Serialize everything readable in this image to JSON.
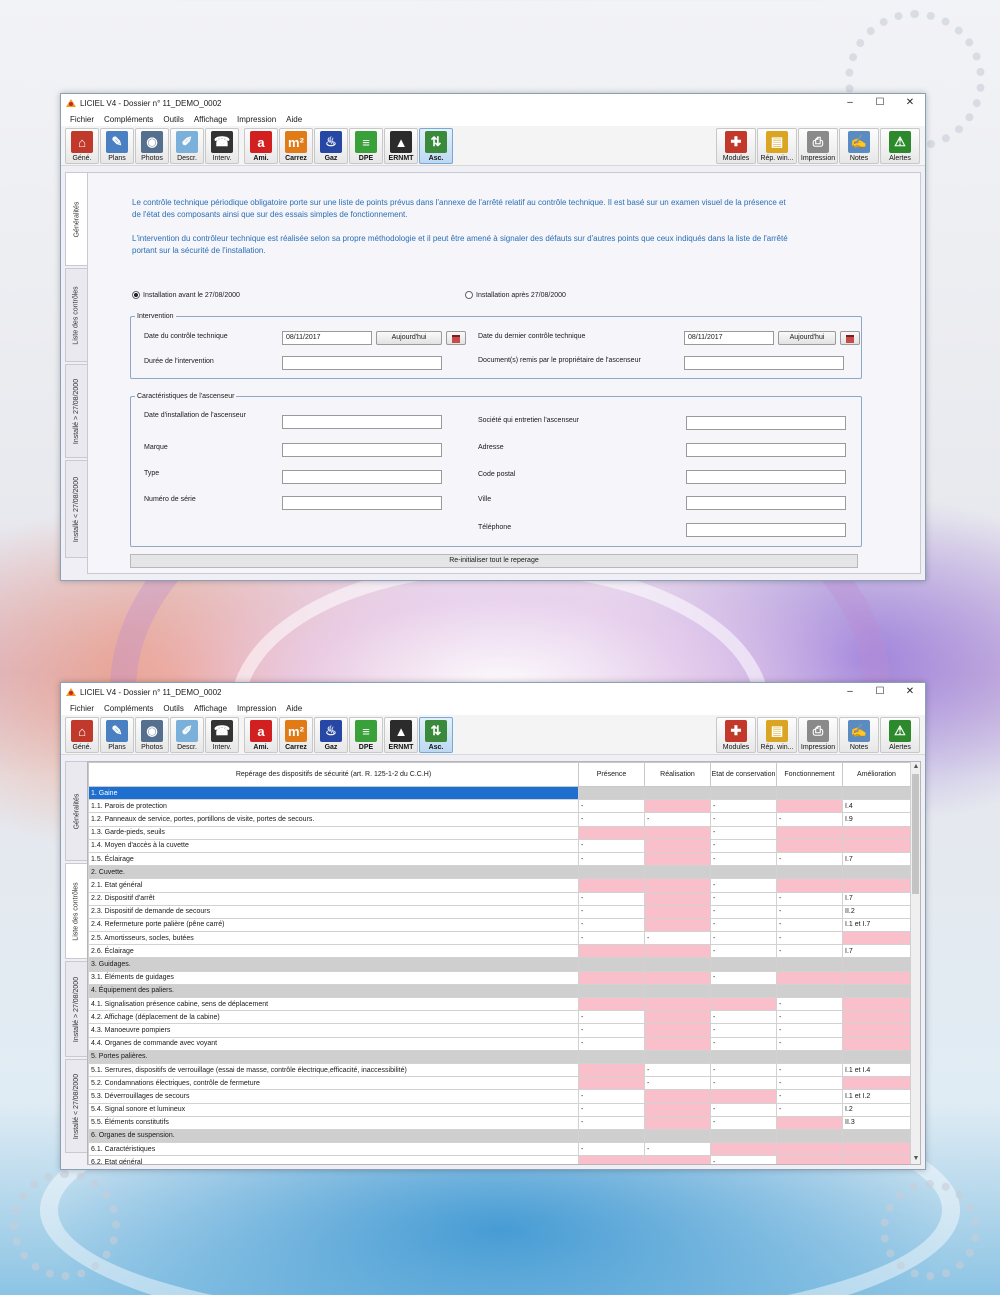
{
  "window1": {
    "title": "LICIEL V4 - Dossier n° 11_DEMO_0002",
    "vtabs": [
      "Généralités",
      "Liste des contrôles",
      "Installé > 27/08/2000",
      "Installé < 27/08/2000"
    ],
    "intro_p1": "Le contrôle technique périodique obligatoire porte sur une liste de points prévus dans l'annexe de l'arrêté relatif au contrôle technique. Il est basé sur un examen visuel de la présence et de l'état des composants ainsi que sur des essais simples de fonctionnement.",
    "intro_p2": "L'intervention du contrôleur technique est réalisée selon sa propre méthodologie et il peut être amené à signaler des défauts sur d'autres points que ceux indiqués dans la liste de l'arrêté portant sur la sécurité de l'installation.",
    "radio_before": "Installation avant le 27/08/2000",
    "radio_after": "Installation après 27/08/2000",
    "intervention": {
      "legend": "Intervention",
      "last_check_label": "Date du contrôle technique",
      "last_check_value": "08/11/2017",
      "today_label": "Aujourd'hui",
      "prev_check_label": "Date du dernier contrôle technique",
      "prev_check_value": "08/11/2017",
      "duration_label": "Durée de l'intervention",
      "docs_label": "Document(s) remis par le propriétaire de l'ascenseur"
    },
    "characteristics": {
      "legend": "Caractéristiques de l'ascenseur",
      "install_date": "Date d'installation de l'ascenseur",
      "brand": "Marque",
      "type": "Type",
      "serial": "Numéro de série",
      "company": "Société qui entretien l'ascenseur",
      "address": "Adresse",
      "postcode": "Code postal",
      "city": "Ville",
      "phone": "Téléphone"
    },
    "reset_label": "Re-initialiser tout le reperage"
  },
  "window2": {
    "title": "LICIEL V4 - Dossier n° 11_DEMO_0002",
    "vtabs": [
      "Généralités",
      "Liste des contrôles",
      "Installé > 27/08/2000",
      "Installé < 27/08/2000"
    ],
    "columns": [
      "Repérage des dispositifs de sécurité (art. R. 125-1-2 du C.C.H)",
      "Présence",
      "Réalisation",
      "Etat de conservation",
      "Fonctionnement",
      "Amélioration"
    ],
    "rows": [
      {
        "label": "1. Gaine",
        "section": true,
        "selected": true,
        "cells": [
          "none",
          "none",
          "none",
          "none",
          "none"
        ],
        "vals": [
          "",
          "",
          "",
          "",
          ""
        ]
      },
      {
        "label": "1.1. Parois de protection",
        "cells": [
          "none",
          "pink",
          "none",
          "pink",
          "none"
        ],
        "vals": [
          "-",
          "",
          "-",
          "",
          "I.4"
        ]
      },
      {
        "label": "1.2. Panneaux de service, portes, portillons de visite, portes de secours.",
        "cells": [
          "none",
          "none",
          "none",
          "none",
          "none"
        ],
        "vals": [
          "-",
          "-",
          "-",
          "-",
          "I.9"
        ]
      },
      {
        "label": "1.3. Garde-pieds, seuils",
        "cells": [
          "pink",
          "pink",
          "none",
          "pink",
          "pink"
        ],
        "vals": [
          "",
          "",
          "-",
          "",
          ""
        ]
      },
      {
        "label": "1.4. Moyen d'accès à la cuvette",
        "cells": [
          "none",
          "pink",
          "none",
          "pink",
          "pink"
        ],
        "vals": [
          "-",
          "",
          "-",
          "",
          ""
        ]
      },
      {
        "label": "1.5. Éclairage",
        "cells": [
          "none",
          "pink",
          "none",
          "none",
          "none"
        ],
        "vals": [
          "-",
          "",
          "-",
          "-",
          "I.7"
        ]
      },
      {
        "label": "2. Cuvette.",
        "section": true,
        "cells": [
          "grey",
          "grey",
          "grey",
          "grey",
          "grey"
        ],
        "vals": [
          "",
          "",
          "",
          "",
          ""
        ]
      },
      {
        "label": "2.1. Etat général",
        "cells": [
          "pink",
          "pink",
          "none",
          "pink",
          "pink"
        ],
        "vals": [
          "",
          "",
          "-",
          "",
          ""
        ]
      },
      {
        "label": "2.2. Dispositif d'arrêt",
        "cells": [
          "none",
          "pink",
          "none",
          "none",
          "none"
        ],
        "vals": [
          "-",
          "",
          "-",
          "-",
          "I.7"
        ]
      },
      {
        "label": "2.3. Dispositif de demande de secours",
        "cells": [
          "none",
          "pink",
          "none",
          "none",
          "none"
        ],
        "vals": [
          "-",
          "",
          "-",
          "-",
          "II.2"
        ]
      },
      {
        "label": "2.4. Refermeture porte palière (pêne carré)",
        "cells": [
          "none",
          "pink",
          "none",
          "none",
          "none"
        ],
        "vals": [
          "-",
          "",
          "-",
          "-",
          "I.1 et I.7"
        ]
      },
      {
        "label": "2.5. Amortisseurs, socles, butées",
        "cells": [
          "none",
          "none",
          "none",
          "none",
          "pink"
        ],
        "vals": [
          "-",
          "-",
          "-",
          "-",
          ""
        ]
      },
      {
        "label": "2.6. Éclairage",
        "cells": [
          "pink",
          "pink",
          "none",
          "none",
          "none"
        ],
        "vals": [
          "",
          "",
          "-",
          "-",
          "I.7"
        ]
      },
      {
        "label": "3. Guidages.",
        "section": true,
        "cells": [
          "grey",
          "grey",
          "grey",
          "grey",
          "grey"
        ],
        "vals": [
          "",
          "",
          "",
          "",
          ""
        ]
      },
      {
        "label": "3.1. Éléments de guidages",
        "cells": [
          "pink",
          "pink",
          "none",
          "pink",
          "pink"
        ],
        "vals": [
          "",
          "",
          "-",
          "",
          ""
        ]
      },
      {
        "label": "4. Équipement des paliers.",
        "section": true,
        "cells": [
          "grey",
          "grey",
          "grey",
          "grey",
          "grey"
        ],
        "vals": [
          "",
          "",
          "",
          "",
          ""
        ]
      },
      {
        "label": "4.1. Signalisation présence cabine, sens de déplacement",
        "cells": [
          "pink",
          "pink",
          "pink",
          "none",
          "pink"
        ],
        "vals": [
          "",
          "",
          "",
          "-",
          ""
        ]
      },
      {
        "label": "4.2. Affichage (déplacement de la cabine)",
        "cells": [
          "none",
          "pink",
          "none",
          "none",
          "pink"
        ],
        "vals": [
          "-",
          "",
          "-",
          "-",
          ""
        ]
      },
      {
        "label": "4.3. Manoeuvre pompiers",
        "cells": [
          "none",
          "pink",
          "none",
          "none",
          "pink"
        ],
        "vals": [
          "-",
          "",
          "-",
          "-",
          ""
        ]
      },
      {
        "label": "4.4. Organes de commande avec voyant",
        "cells": [
          "none",
          "pink",
          "none",
          "none",
          "pink"
        ],
        "vals": [
          "-",
          "",
          "-",
          "-",
          ""
        ]
      },
      {
        "label": "5. Portes palières.",
        "section": true,
        "cells": [
          "grey",
          "grey",
          "grey",
          "grey",
          "grey"
        ],
        "vals": [
          "",
          "",
          "",
          "",
          ""
        ]
      },
      {
        "label": "5.1. Serrures, dispositifs de verrouillage (essai de masse, contrôle électrique,efficacité, inaccessibilité)",
        "cells": [
          "pink",
          "none",
          "none",
          "none",
          "none"
        ],
        "vals": [
          "",
          "-",
          "-",
          "-",
          "I.1 et I.4"
        ]
      },
      {
        "label": "5.2. Condamnations électriques, contrôle de fermeture",
        "cells": [
          "pink",
          "none",
          "none",
          "none",
          "pink"
        ],
        "vals": [
          "",
          "-",
          "-",
          "-",
          ""
        ]
      },
      {
        "label": "5.3. Déverrouillages de secours",
        "cells": [
          "none",
          "pink",
          "pink",
          "none",
          "none"
        ],
        "vals": [
          "-",
          "",
          "",
          "-",
          "I.1 et I.2"
        ]
      },
      {
        "label": "5.4. Signal sonore et lumineux",
        "cells": [
          "none",
          "pink",
          "none",
          "none",
          "none"
        ],
        "vals": [
          "-",
          "",
          "-",
          "-",
          "I.2"
        ]
      },
      {
        "label": "5.5. Éléments constitutifs",
        "cells": [
          "none",
          "pink",
          "none",
          "pink",
          "none"
        ],
        "vals": [
          "-",
          "",
          "-",
          "",
          "II.3"
        ]
      },
      {
        "label": "6. Organes de suspension.",
        "section": true,
        "cells": [
          "grey",
          "grey",
          "grey",
          "grey",
          "grey"
        ],
        "vals": [
          "",
          "",
          "",
          "",
          ""
        ]
      },
      {
        "label": "6.1. Caractéristiques",
        "cells": [
          "none",
          "none",
          "pink",
          "pink",
          "pink"
        ],
        "vals": [
          "-",
          "-",
          "",
          "",
          ""
        ]
      },
      {
        "label": "6.2. Etat général",
        "cells": [
          "pink",
          "pink",
          "none",
          "pink",
          "pink"
        ],
        "vals": [
          "",
          "",
          "-",
          "",
          ""
        ]
      }
    ]
  },
  "menu": [
    "Fichier",
    "Compléments",
    "Outils",
    "Affichage",
    "Impression",
    "Aide"
  ],
  "toolbar_left": [
    {
      "label": "Géné.",
      "icon": "house-icon",
      "color": "#c0392b",
      "glyph": "⌂"
    },
    {
      "label": "Plans",
      "icon": "plans-icon",
      "color": "#4a7fc1",
      "glyph": "✎"
    },
    {
      "label": "Photos",
      "icon": "camera-icon",
      "color": "#556f8f",
      "glyph": "◉"
    },
    {
      "label": "Descr.",
      "icon": "description-icon",
      "color": "#7ab0d9",
      "glyph": "✐"
    },
    {
      "label": "Interv.",
      "icon": "phone-icon",
      "color": "#333333",
      "glyph": "☎"
    }
  ],
  "toolbar_modules": [
    {
      "label": "Ami.",
      "icon": "amiante-icon",
      "color": "#d21f1f",
      "glyph": "a",
      "bold": true
    },
    {
      "label": "Carrez",
      "icon": "carrez-icon",
      "color": "#e07b18",
      "glyph": "m²",
      "bold": true
    },
    {
      "label": "Gaz",
      "icon": "gas-icon",
      "color": "#2747a5",
      "glyph": "♨",
      "bold": true
    },
    {
      "label": "DPE",
      "icon": "dpe-icon",
      "color": "#3aa13a",
      "glyph": "≡",
      "bold": true
    },
    {
      "label": "ERNMT",
      "icon": "ernmt-icon",
      "color": "#2b2b2b",
      "glyph": "▲",
      "bold": true
    },
    {
      "label": "Asc.",
      "icon": "elevator-icon",
      "color": "#3b8a3b",
      "glyph": "⇅",
      "bold": true,
      "selected": true
    }
  ],
  "toolbar_right": [
    {
      "label": "Modules",
      "icon": "modules-icon",
      "color": "#c2392b",
      "glyph": "✚"
    },
    {
      "label": "Rép. win...",
      "icon": "folder-icon",
      "color": "#d9a522",
      "glyph": "▤"
    },
    {
      "label": "Impression",
      "icon": "printer-icon",
      "color": "#8a8a8a",
      "glyph": "⎙"
    },
    {
      "label": "Notes",
      "icon": "notes-icon",
      "color": "#5a8cc2",
      "glyph": "✍"
    },
    {
      "label": "Alertes",
      "icon": "alert-icon",
      "color": "#2c8a2c",
      "glyph": "⚠"
    }
  ],
  "window_controls": [
    "–",
    "☐",
    "✕"
  ]
}
